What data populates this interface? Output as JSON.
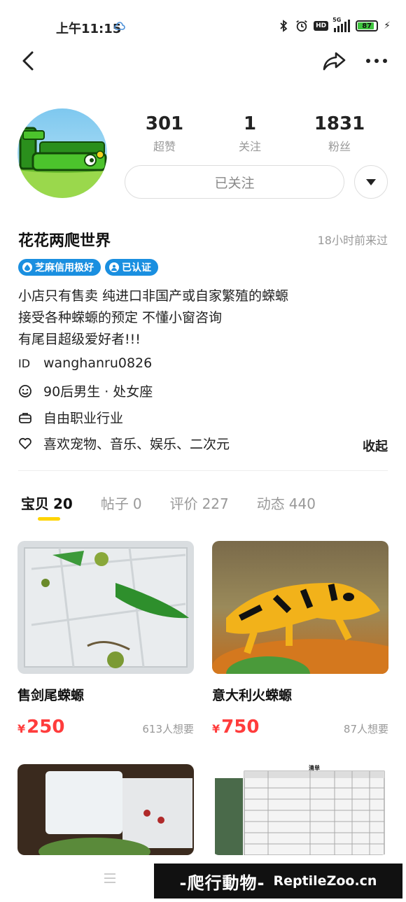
{
  "status_bar": {
    "time": "上午11:15",
    "network": "5G",
    "hd": "HD",
    "battery": "87"
  },
  "profile": {
    "stats": [
      {
        "value": "301",
        "label": "超赞"
      },
      {
        "value": "1",
        "label": "关注"
      },
      {
        "value": "1831",
        "label": "粉丝"
      }
    ],
    "follow_label": "已关注",
    "name": "花花两爬世界",
    "last_seen": "18小时前来过",
    "badges": [
      "芝麻信用极好",
      "已认证"
    ],
    "bio": [
      "小店只有售卖 纯进口非国产或自家繁殖的蝾螈",
      "接受各种蝾螈的预定 不懂小窗咨询",
      "有尾目超级爱好者!!!"
    ],
    "id_label": "ID",
    "id_value": "wanghanru0826",
    "age_sign": "90后男生 · 处女座",
    "job": "自由职业行业",
    "hobbies": "喜欢宠物、音乐、娱乐、二次元",
    "collapse_label": "收起"
  },
  "tabs": [
    {
      "label": "宝贝",
      "count": "20"
    },
    {
      "label": "帖子",
      "count": "0"
    },
    {
      "label": "评价",
      "count": "227"
    },
    {
      "label": "动态",
      "count": "440"
    }
  ],
  "products": [
    {
      "title": "售剑尾蝾螈",
      "currency": "¥",
      "price": "250",
      "wants": "613人想要"
    },
    {
      "title": "意大利火蝾螈",
      "currency": "¥",
      "price": "750",
      "wants": "87人想要"
    }
  ],
  "list_doc": {
    "heading": "清单"
  },
  "watermark": {
    "cn": "-爬行動物-",
    "en": "ReptileZoo.cn"
  },
  "colors": {
    "accent_yellow": "#ffd400",
    "price_red": "#ff3c3c",
    "badge_blue": "#1a8fe0"
  }
}
